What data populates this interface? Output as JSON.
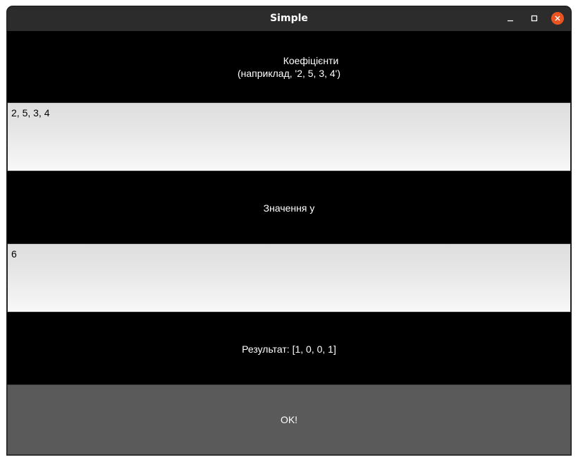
{
  "window": {
    "title": "Simple",
    "controls": {
      "minimize_icon": "minimize-icon",
      "maximize_icon": "maximize-icon",
      "close_icon": "close-icon",
      "close_color": "#e95420"
    }
  },
  "form": {
    "coefficients_label_line1": "Коефіцієнти",
    "coefficients_label_line2": "(наприклад, '2, 5, 3, 4')",
    "coefficients_value": "2, 5, 3, 4",
    "y_label": "Значення у",
    "y_value": "6",
    "result_label": "Результат: [1, 0, 0, 1]",
    "ok_label": "OK!"
  },
  "colors": {
    "background": "#000000",
    "titlebar": "#2c2c2c",
    "button": "#5a5a5a",
    "text_light": "#ffffff"
  }
}
